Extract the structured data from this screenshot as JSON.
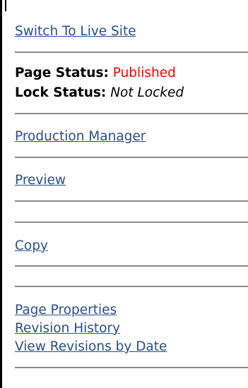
{
  "nav": {
    "switch_live": "Switch To Live Site",
    "production_manager": "Production Manager",
    "preview": "Preview",
    "copy": "Copy",
    "page_properties": "Page Properties",
    "revision_history": "Revision History",
    "view_revisions_by_date": "View Revisions by Date"
  },
  "status": {
    "page_label": "Page Status:",
    "page_value": "Published",
    "lock_label": "Lock Status:",
    "lock_value": "Not Locked"
  },
  "colors": {
    "link": "#2a4e8c",
    "published": "#ff0000",
    "separator": "#8a8a8a"
  }
}
